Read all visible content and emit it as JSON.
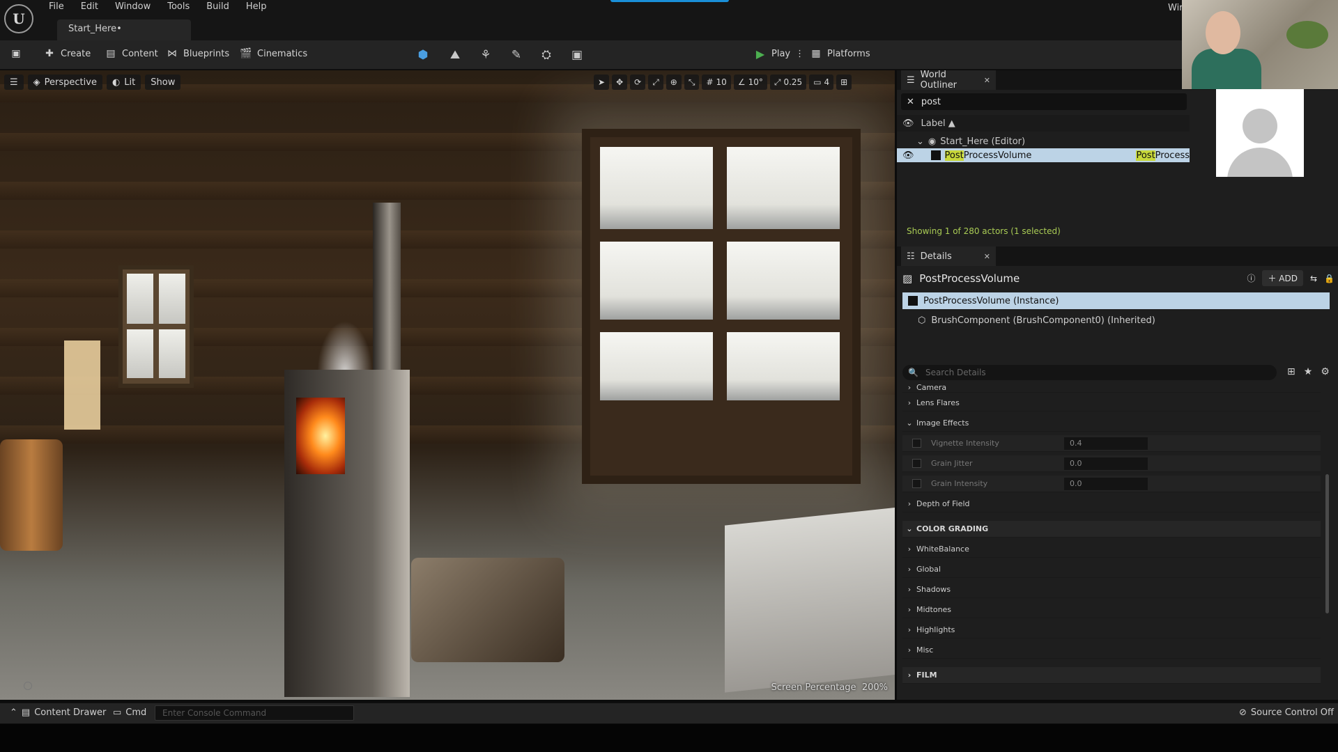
{
  "app": {
    "level_tab": "Start_Here•",
    "window_label": "Wir"
  },
  "menu": [
    "File",
    "Edit",
    "Window",
    "Tools",
    "Build",
    "Help"
  ],
  "toolbar": {
    "create": "Create",
    "content": "Content",
    "blueprints": "Blueprints",
    "cinematics": "Cinematics",
    "play": "Play",
    "platforms": "Platforms"
  },
  "viewport": {
    "perspective": "Perspective",
    "lit": "Lit",
    "show": "Show",
    "grid_snap": "10",
    "rot_snap": "10°",
    "scale_snap": "0.25",
    "camera_speed": "4",
    "screen_percentage_label": "Screen Percentage",
    "screen_percentage_value": "200%"
  },
  "outliner": {
    "tab_label": "World Outliner",
    "search_value": "post",
    "column_label": "Label",
    "rows": [
      {
        "label": "Start_Here (Editor)",
        "type": ""
      },
      {
        "label_highlight": "Post",
        "label_rest": "ProcessVolume",
        "type_highlight": "Post",
        "type_rest": "Process"
      }
    ],
    "status": "Showing 1 of 280 actors (1 selected)"
  },
  "details": {
    "tab_label": "Details",
    "object_name": "PostProcessVolume",
    "add_label": "ADD",
    "instance_label": "PostProcessVolume (Instance)",
    "brush_label": "BrushComponent (BrushComponent0) (Inherited)",
    "search_placeholder": "Search Details",
    "properties": {
      "camera": "Camera",
      "lens_flares": "Lens Flares",
      "image_effects": "Image Effects",
      "vignette_label": "Vignette Intensity",
      "vignette_value": "0.4",
      "grain_jitter_label": "Grain Jitter",
      "grain_jitter_value": "0.0",
      "grain_intensity_label": "Grain Intensity",
      "grain_intensity_value": "0.0",
      "depth_of_field": "Depth of Field",
      "color_grading": "COLOR GRADING",
      "white_balance": "WhiteBalance",
      "global": "Global",
      "shadows": "Shadows",
      "midtones": "Midtones",
      "highlights": "Highlights",
      "misc": "Misc",
      "film": "FILM"
    }
  },
  "bottom": {
    "content_drawer": "Content Drawer",
    "cmd": "Cmd",
    "console_placeholder": "Enter Console Command",
    "source_control": "Source Control Off"
  },
  "colors": {
    "accent_blue": "#1a8fd8",
    "play_green": "#4caf50",
    "selection": "#bcd3e6",
    "outliner_status": "#aacc55",
    "highlight_yellow": "#c8d83a"
  }
}
